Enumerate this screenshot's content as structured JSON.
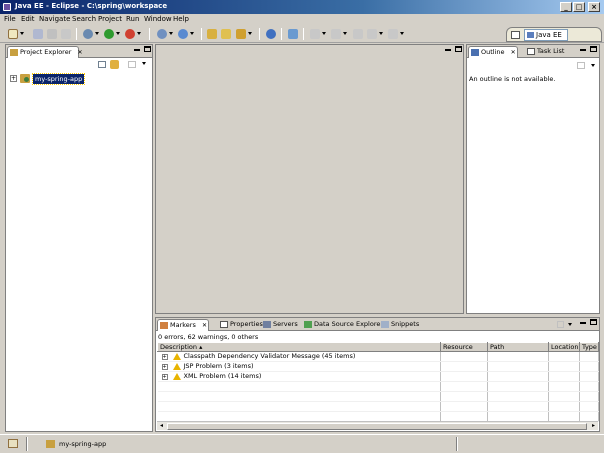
{
  "window": {
    "title": "Java EE - Eclipse - C:\\spring\\workspace",
    "controls": {
      "minimize": "_",
      "maximize": "□",
      "close": "×"
    }
  },
  "menu": [
    "File",
    "Edit",
    "Navigate",
    "Search",
    "Project",
    "Run",
    "Window",
    "Help"
  ],
  "perspective": {
    "label": "Java EE"
  },
  "explorer": {
    "tab_label": "Project Explorer",
    "tree": [
      {
        "label": "my-spring-app",
        "expander": "+"
      }
    ]
  },
  "outline": {
    "tabs": [
      "Outline",
      "Task List"
    ],
    "message": "An outline is not available."
  },
  "markers": {
    "tabs": [
      "Markers",
      "Properties",
      "Servers",
      "Data Source Explorer",
      "Snippets"
    ],
    "summary": "0 errors, 62 warnings, 0 others",
    "columns": [
      "Description",
      "Resource",
      "Path",
      "Location",
      "Type"
    ],
    "rows": [
      {
        "description": "Classpath Dependency Validator Message (45 items)",
        "resource": "",
        "path": "",
        "location": "",
        "type": ""
      },
      {
        "description": "JSP Problem (3 items)",
        "resource": "",
        "path": "",
        "location": "",
        "type": ""
      },
      {
        "description": "XML Problem (14 items)",
        "resource": "",
        "path": "",
        "location": "",
        "type": ""
      }
    ]
  },
  "status": {
    "selected_project": "my-spring-app"
  },
  "colors": {
    "title_start": "#0a246a",
    "title_end": "#a6caf0",
    "chrome": "#d4d0c8",
    "selection": "#0a246a",
    "warning": "#e8b400"
  }
}
